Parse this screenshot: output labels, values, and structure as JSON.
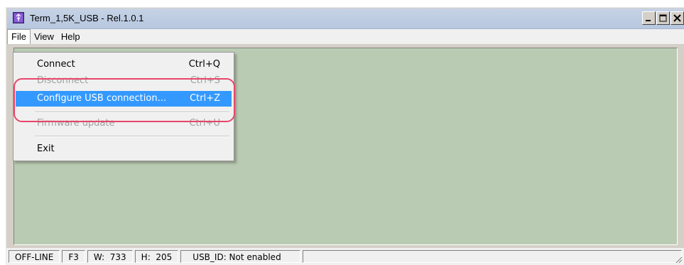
{
  "window": {
    "title": "Term_1,5K_USB - Rel.1.0.1",
    "controls": {
      "minimize": "minimize-icon",
      "maximize": "maximize-icon",
      "close": "close-icon"
    }
  },
  "menubar": {
    "items": [
      {
        "label": "File"
      },
      {
        "label": "View"
      },
      {
        "label": "Help"
      }
    ]
  },
  "file_menu": {
    "items": [
      {
        "label": "Connect",
        "shortcut": "Ctrl+Q",
        "enabled": true
      },
      {
        "label": "Disconnect",
        "shortcut": "Ctrl+S",
        "enabled": false
      },
      {
        "label": "Configure USB connection...",
        "shortcut": "Ctrl+Z",
        "enabled": true,
        "selected": true
      },
      {
        "label": "Firmware update",
        "shortcut": "Ctrl+U",
        "enabled": false
      },
      {
        "label": "Exit",
        "shortcut": "",
        "enabled": true
      }
    ]
  },
  "statusbar": {
    "state": "OFF-LINE",
    "key": "F3",
    "width": "W:  733",
    "height": "H:  205",
    "usb_id": "USB_ID: Not enabled"
  },
  "colors": {
    "content_bg": "#bacbb3",
    "selection": "#3399ff",
    "annotation": "#e8456a"
  }
}
